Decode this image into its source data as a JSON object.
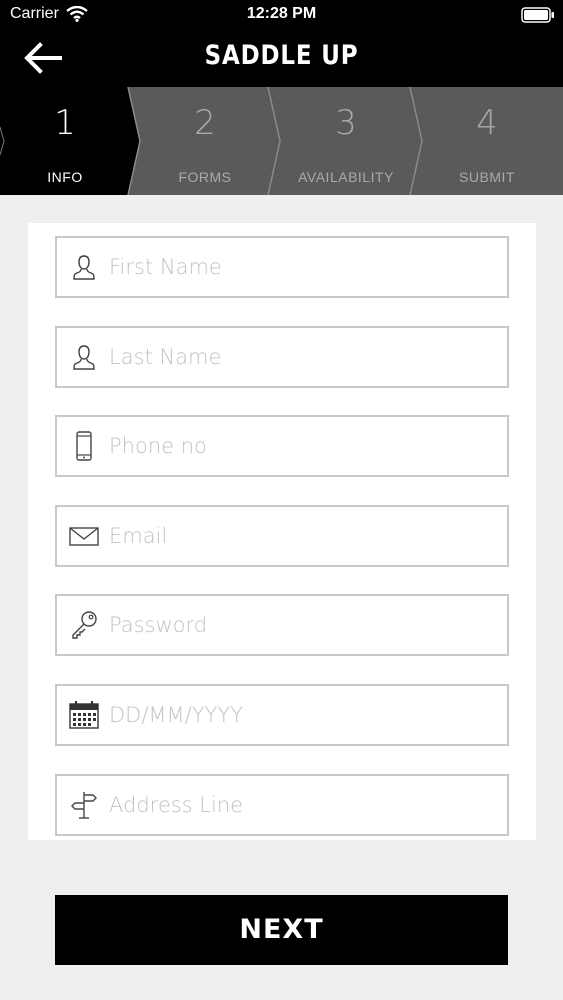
{
  "status_bar": {
    "carrier": "Carrier",
    "time": "12:28 PM"
  },
  "nav": {
    "title": "SADDLE UP"
  },
  "steps": [
    {
      "number": "1",
      "label": "INFO",
      "active": true
    },
    {
      "number": "2",
      "label": "FORMS",
      "active": false
    },
    {
      "number": "3",
      "label": "AVAILABILITY",
      "active": false
    },
    {
      "number": "4",
      "label": "SUBMIT",
      "active": false
    }
  ],
  "form": {
    "fields": [
      {
        "icon": "person-icon",
        "placeholder": "First Name",
        "value": ""
      },
      {
        "icon": "person-icon",
        "placeholder": "Last Name",
        "value": ""
      },
      {
        "icon": "phone-icon",
        "placeholder": "Phone no",
        "value": ""
      },
      {
        "icon": "envelope-icon",
        "placeholder": "Email",
        "value": ""
      },
      {
        "icon": "key-icon",
        "placeholder": "Password",
        "value": ""
      },
      {
        "icon": "calendar-icon",
        "placeholder": "DD/MM/YYYY",
        "value": ""
      },
      {
        "icon": "signpost-icon",
        "placeholder": "Address Line",
        "value": ""
      }
    ]
  },
  "next_button": {
    "label": "NEXT"
  },
  "colors": {
    "header": "#000000",
    "stepper_inactive": "#5a5a5a",
    "background": "#efeef0",
    "field_border": "#c9c9cb"
  }
}
